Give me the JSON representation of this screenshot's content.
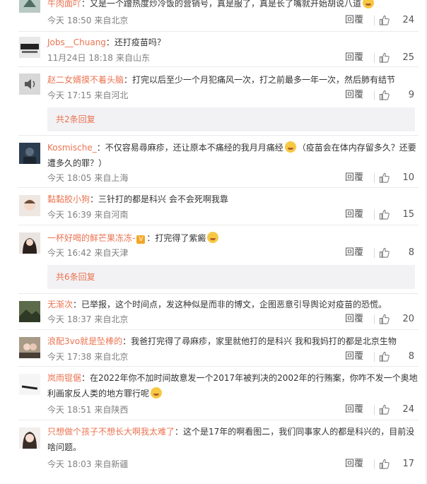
{
  "comments": [
    {
      "username": "牛肉面吖",
      "text": "：又是一个蹭热度炒冷饭的营销号，真是服了，真是长了嘴就开始胡说八道",
      "time": "今天 18:50",
      "location": "来自北京",
      "reply": "回覆",
      "likes": "24",
      "emoji_after": true
    },
    {
      "username": "Jobs__Chuang",
      "text": "：还打疫苗吗？",
      "time": "11月24日 18:18",
      "location": "来自山东",
      "reply": "回覆",
      "likes": "25"
    },
    {
      "username": "赵二女婿摸不着头脑",
      "text": "：打完以后至少一个月犯痛风一次，打之前最多一年一次，然后肺有结节",
      "time": "今天 17:15",
      "location": "来自河北",
      "reply": "回覆",
      "likes": "9",
      "more": "共2条回复"
    },
    {
      "username": "Kosmische_",
      "text": "：不仅容易尋麻疹，还让原本不痛经的我月月痛经",
      "text2": "（疫苗会在体内存留多久？还要遭多久的罪？）",
      "time": "今天 18:05",
      "location": "来自上海",
      "reply": "回覆",
      "likes": "10"
    },
    {
      "username": "黏黏胶小狗",
      "text": "：三针打的都是科兴 会不会死啊我靠",
      "time": "今天 16:39",
      "location": "来自河南",
      "reply": "回覆",
      "likes": "15"
    },
    {
      "username": "一杯好喝的鲜芒果冻冻-",
      "text": "：打完得了紫癜",
      "time": "今天 16:42",
      "location": "来自天津",
      "reply": "回覆",
      "likes": "8",
      "more": "共6条回复"
    },
    {
      "username": "无渐次",
      "text": "：已举报，这个时间点，发这种似是而非的博文，企图恶意引导舆论对疫苗的恐慌。",
      "time": "今天 18:37",
      "location": "来自北京",
      "reply": "回覆",
      "likes": "20"
    },
    {
      "username": "浪配3vo就是坠棒的",
      "text": "：我爸打完得了尋麻疹，家里就他打的是科兴 我和我妈打的都是北京生物",
      "time": "今天 17:38",
      "location": "来自北京",
      "reply": "回覆",
      "likes": "8"
    },
    {
      "username": "岚雨锟倨",
      "text": "：在2022年你不加时间故意发一个2017年被判决的2002年的行贿案，你咋不发一个奥地利画家反人类的地方罪行呢",
      "time": "今天 18:51",
      "location": "来自陕西",
      "reply": "回覆",
      "likes": "24"
    },
    {
      "username": "只想做个孩子不想长大啊我太难了",
      "text": "：这个是17年的啊看图二，我们同事家人的都是科兴的，目前没啥问题。",
      "time": "今天 18:03",
      "location": "来自新疆",
      "reply": "回覆",
      "likes": "17"
    }
  ],
  "colors": {
    "username": "#eb7350",
    "meta": "#808080",
    "more_bg": "#f2f2f5"
  },
  "icons": {
    "like": "thumbs-up-icon",
    "emoji": "smile-emoji-icon"
  }
}
